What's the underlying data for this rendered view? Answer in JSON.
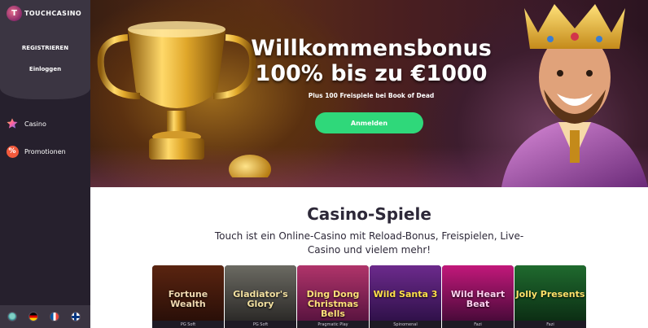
{
  "brand": {
    "name": "TOUCHCASINO"
  },
  "sidebar": {
    "register_label": "REGISTRIEREN",
    "login_label": "Einloggen",
    "nav": [
      {
        "label": "Casino",
        "icon": "star-icon"
      },
      {
        "label": "Promotionen",
        "icon": "promotions-icon"
      }
    ],
    "languages": [
      "globe-icon",
      "flag-de-icon",
      "flag-fr-icon",
      "flag-fi-icon"
    ]
  },
  "hero": {
    "title_line1": "Willkommensbonus",
    "title_line2": "100% bis zu €1000",
    "subtitle": "Plus 100 Freispiele bei Book of Dead",
    "cta_label": "Anmelden"
  },
  "section": {
    "title": "Casino-Spiele",
    "description": "Touch ist ein Online-Casino mit Reload-Bonus, Freispielen, Live-Casino und vielem mehr!"
  },
  "games": [
    {
      "title": "Fortune Wealth",
      "provider": "PG Soft",
      "color_top": "#5a2410",
      "color_bottom": "#2a0f08",
      "text_color": "#f0d8b0"
    },
    {
      "title": "Gladiator's Glory",
      "provider": "PG Soft",
      "color_top": "#6b6a62",
      "color_bottom": "#2c2a28",
      "text_color": "#f2e0a0"
    },
    {
      "title": "Ding Dong Christmas Bells",
      "provider": "Pragmatic Play",
      "color_top": "#b0346a",
      "color_bottom": "#5a1440",
      "text_color": "#ffe07a"
    },
    {
      "title": "Wild Santa 3",
      "provider": "Spinomenal",
      "color_top": "#6c2a8c",
      "color_bottom": "#30114a",
      "text_color": "#ffe04a"
    },
    {
      "title": "Wild Heart Beat",
      "provider": "Fazi",
      "color_top": "#c2187a",
      "color_bottom": "#4a0a3a",
      "text_color": "#ffd0f0"
    },
    {
      "title": "Jolly Presents",
      "provider": "Fazi",
      "color_top": "#1f6a2e",
      "color_bottom": "#0c2e14",
      "text_color": "#ffe26a"
    }
  ],
  "colors": {
    "sidebar_bg": "#26202d",
    "cta_green": "#2fd87a",
    "heading_text": "#2d2838"
  }
}
